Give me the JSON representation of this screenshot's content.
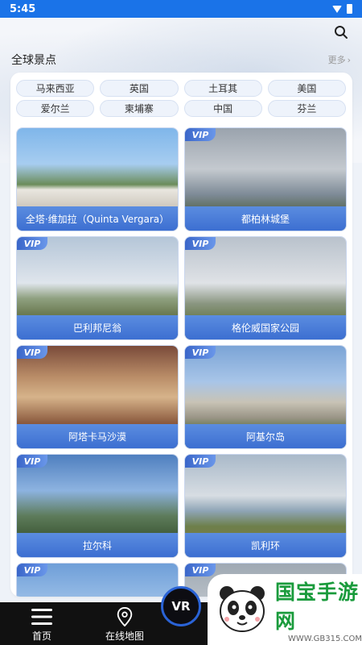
{
  "status_bar": {
    "time": "5:45"
  },
  "header": {
    "title": "全球景点",
    "more_label": "更多"
  },
  "countries": [
    "马来西亚",
    "英国",
    "土耳其",
    "美国",
    "爱尔兰",
    "柬埔寨",
    "中国",
    "芬兰"
  ],
  "spots": [
    {
      "name": "全塔·维加拉（Quinta Vergara）",
      "vip": false
    },
    {
      "name": "都柏林城堡",
      "vip": true
    },
    {
      "name": "巴利邦尼翁",
      "vip": true
    },
    {
      "name": "格伦威国家公园",
      "vip": true
    },
    {
      "name": "阿塔卡马沙漠",
      "vip": true
    },
    {
      "name": "阿基尔岛",
      "vip": true
    },
    {
      "name": "拉尔科",
      "vip": true
    },
    {
      "name": "凯利环",
      "vip": true
    },
    {
      "name": "",
      "vip": true
    },
    {
      "name": "",
      "vip": true
    }
  ],
  "vip_label": "VIP",
  "nav": {
    "home_label": "首页",
    "map_label": "在线地图",
    "vr_label": "VR"
  },
  "watermark": {
    "title": "国宝手游网",
    "url": "WWW.GB315.COM"
  },
  "colors": {
    "accent": "#3c6fd1",
    "nav_bg": "#111111",
    "watermark_green": "#1a9b3c"
  }
}
